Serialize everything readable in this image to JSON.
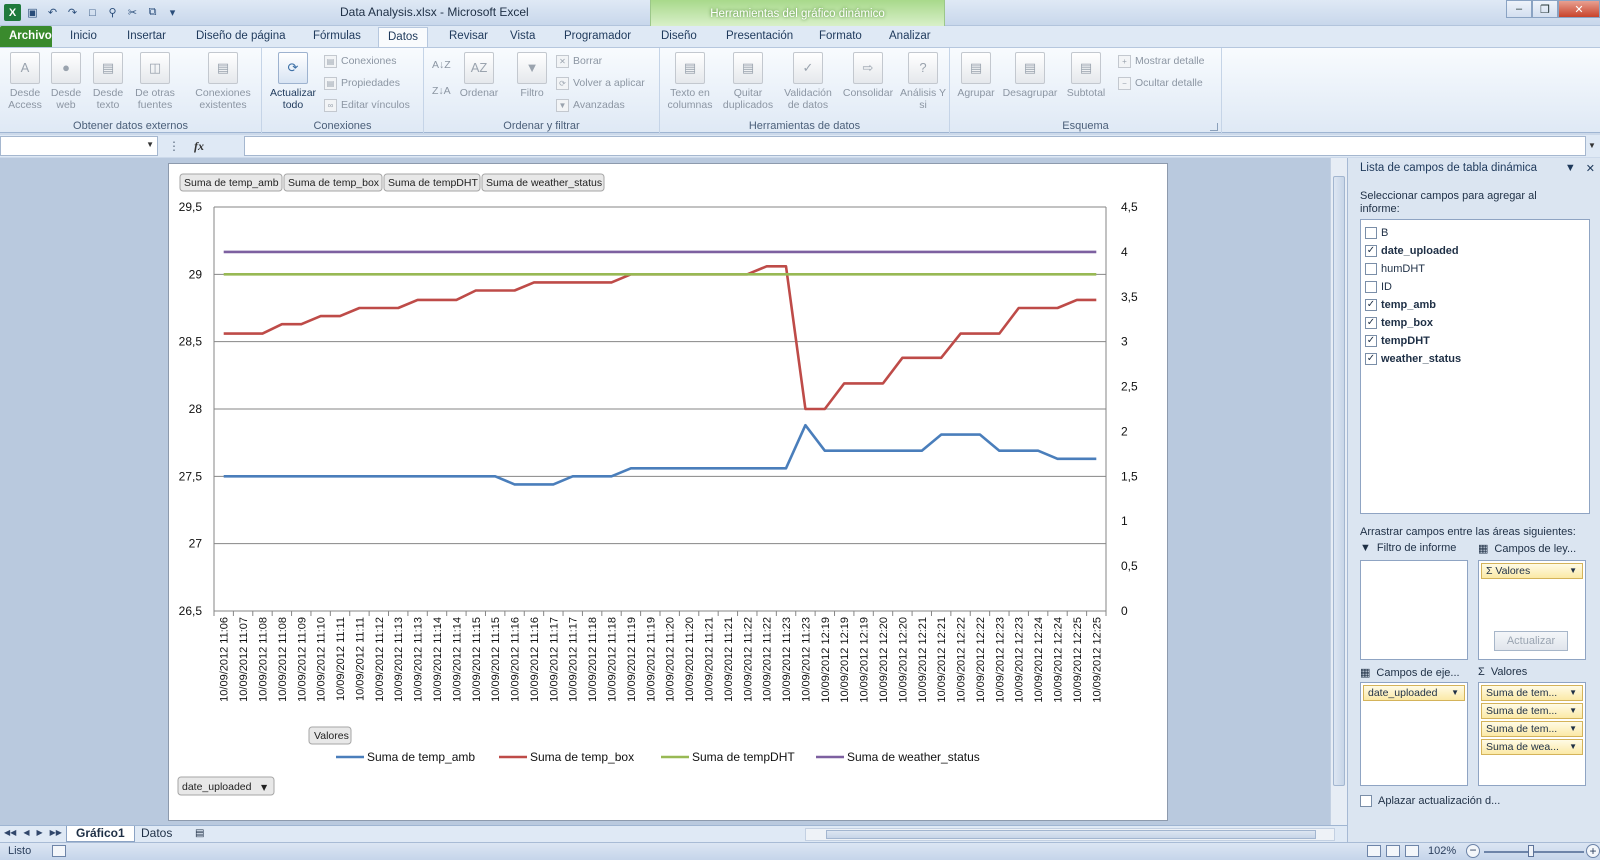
{
  "window": {
    "title": "Data Analysis.xlsx  -  Microsoft Excel",
    "context_tab": "Herramientas del gráfico dinámico"
  },
  "tabs": [
    "Archivo",
    "Inicio",
    "Insertar",
    "Diseño de página",
    "Fórmulas",
    "Datos",
    "Revisar",
    "Vista",
    "Programador",
    "Diseño",
    "Presentación",
    "Formato",
    "Analizar"
  ],
  "active_tab": "Datos",
  "ribbon": {
    "groups": [
      {
        "label": "Obtener datos externos",
        "buttons": [
          "Desde Access",
          "Desde web",
          "Desde texto",
          "De otras fuentes",
          "Conexiones existentes"
        ]
      },
      {
        "label": "Conexiones",
        "buttons": [
          "Actualizar todo"
        ],
        "small": [
          "Conexiones",
          "Propiedades",
          "Editar vínculos"
        ]
      },
      {
        "label": "Ordenar y filtrar",
        "buttons": [
          "Ordenar",
          "Filtro"
        ],
        "small": [
          "Borrar",
          "Volver a aplicar",
          "Avanzadas"
        ]
      },
      {
        "label": "Herramientas de datos",
        "buttons": [
          "Texto en columnas",
          "Quitar duplicados",
          "Validación de datos",
          "Consolidar",
          "Análisis Y si"
        ]
      },
      {
        "label": "Esquema",
        "buttons": [
          "Agrupar",
          "Desagrupar",
          "Subtotal"
        ],
        "small": [
          "Mostrar detalle",
          "Ocultar detalle"
        ]
      }
    ]
  },
  "formula_bar": {
    "name_box": "",
    "fx": "fx",
    "value": ""
  },
  "chart": {
    "value_buttons": [
      "Suma de temp_amb",
      "Suma de temp_box",
      "Suma de tempDHT",
      "Suma de weather_status"
    ],
    "values_button": "Valores",
    "axis_field_button": "date_uploaded"
  },
  "chart_data": {
    "type": "line",
    "categories": [
      "10/09/2012 11:06",
      "10/09/2012 11:07",
      "10/09/2012 11:08",
      "10/09/2012 11:08",
      "10/09/2012 11:09",
      "10/09/2012 11:10",
      "10/09/2012 11:11",
      "10/09/2012 11:11",
      "10/09/2012 11:12",
      "10/09/2012 11:13",
      "10/09/2012 11:13",
      "10/09/2012 11:14",
      "10/09/2012 11:14",
      "10/09/2012 11:15",
      "10/09/2012 11:15",
      "10/09/2012 11:16",
      "10/09/2012 11:16",
      "10/09/2012 11:17",
      "10/09/2012 11:17",
      "10/09/2012 11:18",
      "10/09/2012 11:18",
      "10/09/2012 11:19",
      "10/09/2012 11:19",
      "10/09/2012 11:20",
      "10/09/2012 11:20",
      "10/09/2012 11:21",
      "10/09/2012 11:21",
      "10/09/2012 11:22",
      "10/09/2012 11:22",
      "10/09/2012 11:23",
      "10/09/2012 11:23",
      "10/09/2012 12:19",
      "10/09/2012 12:19",
      "10/09/2012 12:19",
      "10/09/2012 12:20",
      "10/09/2012 12:20",
      "10/09/2012 12:21",
      "10/09/2012 12:21",
      "10/09/2012 12:22",
      "10/09/2012 12:22",
      "10/09/2012 12:23",
      "10/09/2012 12:23",
      "10/09/2012 12:24",
      "10/09/2012 12:24",
      "10/09/2012 12:25",
      "10/09/2012 12:25"
    ],
    "series": [
      {
        "name": "Suma de temp_amb",
        "axis": "primary",
        "color": "#4a7ebb",
        "values": [
          27.5,
          27.5,
          27.5,
          27.5,
          27.5,
          27.5,
          27.5,
          27.5,
          27.5,
          27.5,
          27.5,
          27.5,
          27.5,
          27.5,
          27.5,
          27.44,
          27.44,
          27.44,
          27.5,
          27.5,
          27.5,
          27.56,
          27.56,
          27.56,
          27.56,
          27.56,
          27.56,
          27.56,
          27.56,
          27.56,
          27.88,
          27.69,
          27.69,
          27.69,
          27.69,
          27.69,
          27.69,
          27.81,
          27.81,
          27.81,
          27.69,
          27.69,
          27.69,
          27.63,
          27.63,
          27.63
        ]
      },
      {
        "name": "Suma de temp_box",
        "axis": "primary",
        "color": "#be4b48",
        "values": [
          28.56,
          28.56,
          28.56,
          28.63,
          28.63,
          28.69,
          28.69,
          28.75,
          28.75,
          28.75,
          28.81,
          28.81,
          28.81,
          28.88,
          28.88,
          28.88,
          28.94,
          28.94,
          28.94,
          28.94,
          28.94,
          29.0,
          29.0,
          29.0,
          29.0,
          29.0,
          29.0,
          29.0,
          29.06,
          29.06,
          28.0,
          28.0,
          28.19,
          28.19,
          28.19,
          28.38,
          28.38,
          28.38,
          28.56,
          28.56,
          28.56,
          28.75,
          28.75,
          28.75,
          28.81,
          28.81
        ]
      },
      {
        "name": "Suma de tempDHT",
        "axis": "primary",
        "color": "#98b954",
        "values": [
          29,
          29,
          29,
          29,
          29,
          29,
          29,
          29,
          29,
          29,
          29,
          29,
          29,
          29,
          29,
          29,
          29,
          29,
          29,
          29,
          29,
          29,
          29,
          29,
          29,
          29,
          29,
          29,
          29,
          29,
          29,
          29,
          29,
          29,
          29,
          29,
          29,
          29,
          29,
          29,
          29,
          29,
          29,
          29,
          29,
          29
        ]
      },
      {
        "name": "Suma de weather_status",
        "axis": "secondary",
        "color": "#7d60a0",
        "values": [
          4,
          4,
          4,
          4,
          4,
          4,
          4,
          4,
          4,
          4,
          4,
          4,
          4,
          4,
          4,
          4,
          4,
          4,
          4,
          4,
          4,
          4,
          4,
          4,
          4,
          4,
          4,
          4,
          4,
          4,
          4,
          4,
          4,
          4,
          4,
          4,
          4,
          4,
          4,
          4,
          4,
          4,
          4,
          4,
          4,
          4
        ]
      }
    ],
    "ylim": [
      26.5,
      29.5
    ],
    "yticks": [
      "26,5",
      "27",
      "27,5",
      "28",
      "28,5",
      "29",
      "29,5"
    ],
    "y2lim": [
      0,
      4.5
    ],
    "y2ticks": [
      "0",
      "0,5",
      "1",
      "1,5",
      "2",
      "2,5",
      "3",
      "3,5",
      "4",
      "4,5"
    ],
    "legend": "bottom",
    "grid": true
  },
  "sheets": [
    "Gráfico1",
    "Datos"
  ],
  "status": {
    "ready": "Listo",
    "zoom": "102%"
  },
  "panel": {
    "title": "Lista de campos de tabla dinámica",
    "select_label": "Seleccionar campos para agregar al informe:",
    "fields": [
      {
        "name": "B",
        "checked": false
      },
      {
        "name": "date_uploaded",
        "checked": true
      },
      {
        "name": "humDHT",
        "checked": false
      },
      {
        "name": "ID",
        "checked": false
      },
      {
        "name": "temp_amb",
        "checked": true
      },
      {
        "name": "temp_box",
        "checked": true
      },
      {
        "name": "tempDHT",
        "checked": true
      },
      {
        "name": "weather_status",
        "checked": true
      }
    ],
    "drag_label": "Arrastrar campos entre las áreas siguientes:",
    "areas": {
      "report_filter": "Filtro de informe",
      "legend_fields": "Campos de ley...",
      "legend_items": [
        "Valores"
      ],
      "axis_fields": "Campos de eje...",
      "axis_items": [
        "date_uploaded"
      ],
      "values": "Valores",
      "value_items": [
        "Suma de tem...",
        "Suma de tem...",
        "Suma de tem...",
        "Suma de wea..."
      ]
    },
    "defer_label": "Aplazar actualización d...",
    "update_button": "Actualizar"
  }
}
